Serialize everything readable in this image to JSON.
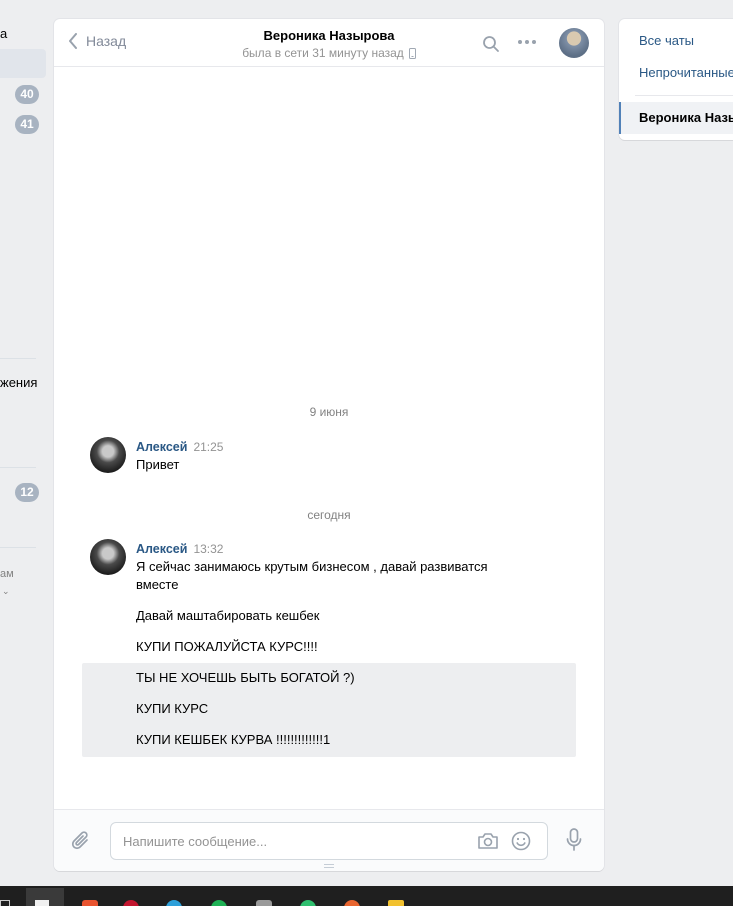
{
  "left_nav": {
    "fragment_top": "а",
    "badge_1": "40",
    "badge_2": "41",
    "fragment_mid": "жения",
    "badge_3": "12",
    "fragment_bottom": "ам"
  },
  "header": {
    "back_label": "Назад",
    "peer_name": "Вероника Назырова",
    "peer_status": "была в сети 31 минуту назад"
  },
  "conversation": {
    "date_1": "9 июня",
    "group_1": {
      "author": "Алексей",
      "time": "21:25",
      "messages": [
        "Привет"
      ]
    },
    "date_2": "сегодня",
    "group_2": {
      "author": "Алексей",
      "time": "13:32",
      "messages": [
        "Я сейчас занимаюсь крутым бизнесом , давай развиватся вместе",
        "Давай маштабировать кешбек",
        "КУПИ ПОЖАЛУЙСТА КУРС!!!!",
        "ТЫ НЕ ХОЧЕШЬ БЫТЬ БОГАТОЙ ?)",
        "КУПИ КУРС",
        "КУПИ КЕШБЕК КУРВА !!!!!!!!!!!!!1"
      ]
    }
  },
  "composer": {
    "placeholder": "Напишите сообщение..."
  },
  "right_panel": {
    "all_chats": "Все чаты",
    "unread": "Непрочитанные",
    "active_chat": "Вероника Назырова"
  },
  "icons": {
    "back": "chevron-left-icon",
    "mobile": "phone-icon",
    "search": "search-icon",
    "more": "more-dots-icon",
    "attach": "paperclip-icon",
    "camera": "camera-icon",
    "emoji": "smile-icon",
    "voice": "microphone-icon"
  },
  "colors": {
    "link": "#2a5885",
    "accent": "#5181b8",
    "badge": "#a8b3c1",
    "background": "#edeef0"
  }
}
